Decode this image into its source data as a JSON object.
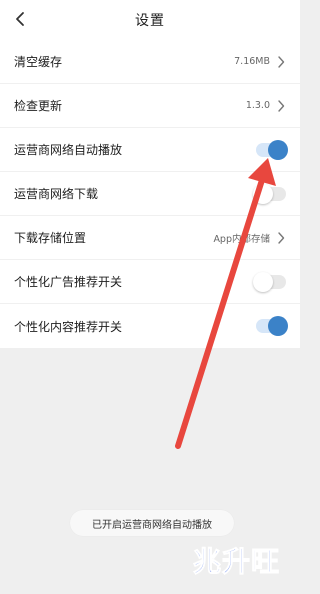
{
  "header": {
    "title": "设置"
  },
  "settings": {
    "items": [
      {
        "label": "清空缓存",
        "value": "7.16MB",
        "control": "chevron"
      },
      {
        "label": "检查更新",
        "value": "1.3.0",
        "control": "chevron"
      },
      {
        "label": "运营商网络自动播放",
        "control": "toggle",
        "state": "on"
      },
      {
        "label": "运营商网络下载",
        "control": "toggle",
        "state": "off"
      },
      {
        "label": "下载存储位置",
        "value": "App内部存储",
        "control": "chevron"
      },
      {
        "label": "个性化广告推荐开关",
        "control": "toggle",
        "state": "off"
      },
      {
        "label": "个性化内容推荐开关",
        "control": "toggle",
        "state": "on"
      }
    ]
  },
  "toast": {
    "message": "已开启运营商网络自动播放"
  },
  "watermark": {
    "text": "兆升旺"
  },
  "icons": {
    "back": "chevron-left-icon",
    "row_arrow": "chevron-right-icon"
  },
  "colors": {
    "accent": "#3b82c8",
    "annotation_arrow": "#e8473e",
    "watermark": "#3d65e8"
  }
}
